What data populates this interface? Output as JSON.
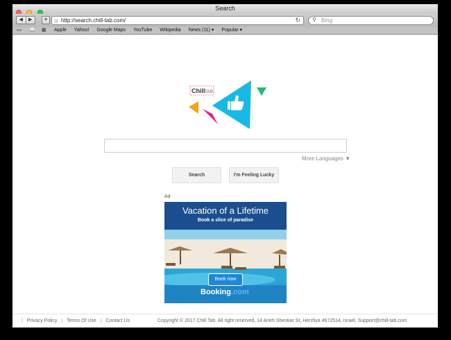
{
  "window": {
    "title": "Search"
  },
  "toolbar": {
    "back_glyph": "◀",
    "forward_glyph": "▶",
    "new_tab_glyph": "+",
    "url": "http://search.chill-tab.com/",
    "reload_glyph": "↻",
    "search_placeholder": "Bing"
  },
  "bookmarks": {
    "items": [
      "Apple",
      "Yahoo!",
      "Google Maps",
      "YouTube",
      "Wikipedia",
      "News (11) ▾",
      "Popular ▾"
    ]
  },
  "logo": {
    "text_chill": "Chill",
    "text_tab": "TAB"
  },
  "search": {
    "more_languages": "More Languages ▼",
    "search_button": "Search",
    "lucky_button": "I'm Feeling Lucky"
  },
  "ad": {
    "label": "Ad",
    "headline": "Vacation of a Lifetime",
    "subheadline": "Book a slice of paradise",
    "cta": "Book now",
    "brand": "Booking",
    "brand_suffix": ".com"
  },
  "footer": {
    "links": [
      "Privacy Policy",
      "Terms Of Use",
      "Contact Us"
    ],
    "copyright": "Copyright © 2017 Chill Tab. All right reserved, 14 Arieh Shenkar St, Herzliya 4672514, Israel, Support@chill-tab.com"
  },
  "colors": {
    "logo_cyan": "#17b9e6",
    "logo_pink": "#e6218c",
    "logo_orange": "#f5a31a",
    "logo_green": "#2ab573",
    "ad_blue": "#1a4e8f"
  }
}
